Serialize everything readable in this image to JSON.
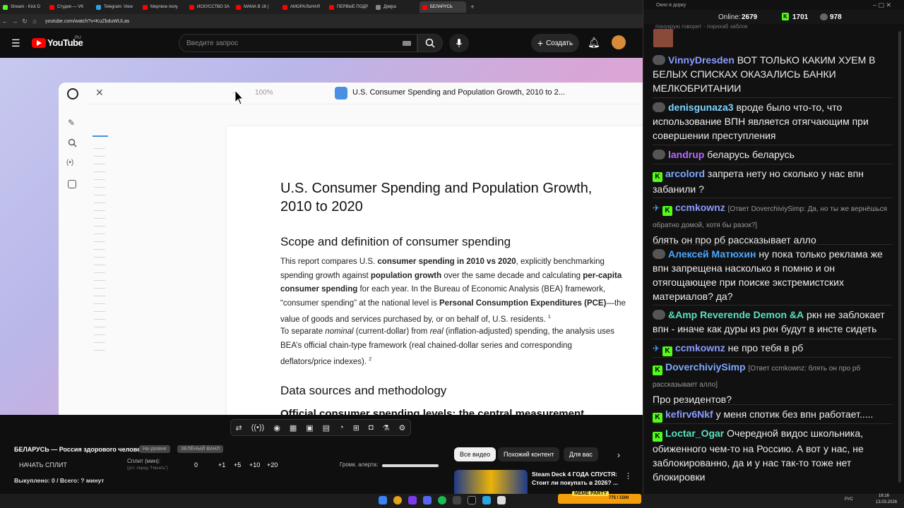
{
  "browser": {
    "tabs": [
      "Stream - Kick D",
      "Студия — VK",
      "Telegram: View",
      "Мертвое полу",
      "ИСКУССТВО ЗА",
      "МАМА В 16 |",
      "АМОРАЛЬНАЯ",
      "ПЕРВЫЕ ПОДР",
      "Д|м|ра",
      "БЕЛАРУСЬ"
    ],
    "url": "youtube.com/watch?v=KuZbduWULas"
  },
  "youtube": {
    "logo": "YouTube",
    "region": "RU",
    "search_placeholder": "Введите запрос",
    "create_label": "Создать"
  },
  "document": {
    "zoom": "100%",
    "tab_title": "U.S. Consumer Spending and Population Growth, 2010 to 2...",
    "title_line1": "U.S. Consumer Spending and Population Growth,",
    "title_line2": "2010 to 2020",
    "h2_scope": "Scope and definition of consumer spending",
    "p1_a": "This report compares U.S. ",
    "p1_b": "consumer spending in 2010 vs 2020",
    "p1_c": ", explicitly benchmarking",
    "p1_d": "spending growth against ",
    "p1_e": "population growth",
    "p1_f": " over the same decade and calculating ",
    "p1_g": "per-capita",
    "p1_h": "consumer spending",
    "p1_i": " for each year. In the Bureau of Economic Analysis (BEA) framework,",
    "p1_j": "“consumer spending” at the national level is ",
    "p1_k": "Personal Consumption Expenditures (PCE)",
    "p1_l": "—the",
    "p1_m": "value of goods and services purchased by, or on behalf of, U.S. residents.",
    "fn1": "1",
    "p2_a": "To separate ",
    "p2_b": "nominal",
    "p2_c": " (current-dollar) from ",
    "p2_d": "real",
    "p2_e": " (inflation-adjusted) spending, the analysis uses",
    "p2_f": "BEA’s official chain-type framework (real chained-dollar series and corresponding",
    "p2_g": "deflators/price indexes).",
    "fn2": "2",
    "h2_data": "Data sources and methodology",
    "cut_line": "Official consumer spending levels: the central measurement"
  },
  "stream_controls": {
    "title": "БЕЛАРУСЬ — Россия здорового человека",
    "tag1": "На уровне",
    "tag2": "ЗЕЛЁНЫЙ ВАНЛ",
    "start_split": "НАЧАТЬ СПЛИТ",
    "split_label": "Сплит (мин):",
    "split_hint": "(уст. перед \"Начать\")",
    "split_value": "0",
    "steps": [
      "+1",
      "+5",
      "+10",
      "+20"
    ],
    "alert_volume": "Громк. алерта:",
    "stats": "Выкуплено: 0 / Всего: ? минут"
  },
  "recommend": {
    "chips": [
      "Все видео",
      "Похожий контент",
      "Для вас"
    ],
    "video_title": "Steam Deck 4 ГОДА СПУСТЯ: Стоит ли покупать в 2026? ..."
  },
  "chat": {
    "window_title": "Окно в дорку",
    "online_label": "Online:",
    "online": "2679",
    "kick_count": "1701",
    "other_count": "978",
    "top_text": "понукрую говорит - порнхаб заблок",
    "messages": [
      {
        "user": "VinnyDresden",
        "color": "#8a9cff",
        "text": "ВОТ ТОЛЬКО КАКИМ ХУЕМ В БЕЛЫХ СПИСКАХ ОКАЗАЛИСЬ БАНКИ МЕЛКОБРИТАНИИ"
      },
      {
        "user": "denisgunaza3",
        "color": "#7fd4ff",
        "text": "вроде было что-то, что использование ВПН является отягчающим при совершении преступления"
      },
      {
        "user": "landrup",
        "color": "#b66cff",
        "text": "беларусь беларусь"
      },
      {
        "user": "arcolord",
        "color": "#7fa8ff",
        "text": "запрета нету но сколько у нас впн забанили ?"
      },
      {
        "user": "ccmkownz",
        "color": "#8a9cff",
        "reply": "[Ответ DoverchiviySimp: Да, но ты же вернёшься обратно домой, хотя бы разок?]",
        "text": "блять он про рб рассказывает алло"
      },
      {
        "user": "Алексей Матюхин",
        "color": "#4aa8ff",
        "text": "ну пока только реклама же впн запрещена насколько я помню и он отягощающее при поиске экстремистских материалов? да?"
      },
      {
        "user": "&Amp Reverende Demon &A",
        "color": "#5ae0c0",
        "text": "ркн не заблокает впн - иначе как дуры из ркн будут в инсте сидеть"
      },
      {
        "user": "ccmkownz",
        "color": "#8a9cff",
        "text": "не про тебя в рб"
      },
      {
        "user": "DoverchiviySimp",
        "color": "#7fa8ff",
        "reply": "[Ответ ccmkownz: блять он про рб рассказывает алло]",
        "text": "Про резидентов?"
      },
      {
        "user": "kefirv6Nkf",
        "color": "#8a9cff",
        "text": "у меня спотик без впн работает....."
      },
      {
        "user": "Loctar_Ogar",
        "color": "#5ae0c0",
        "text": "Очередной видос школьника, обиженного чем-то на Россию. А вот у нас, не заблокированно, да и у нас так-то тоже нет блокировки"
      }
    ]
  },
  "taskbar": {
    "lang": "РУС",
    "time": "16:16",
    "date": "13.03.2026",
    "meme_label": "MEME PARTY",
    "meme_progress": "775 / 1500"
  },
  "colors": {
    "accent_kick": "#53fc18",
    "yt_red": "#ff0000"
  }
}
